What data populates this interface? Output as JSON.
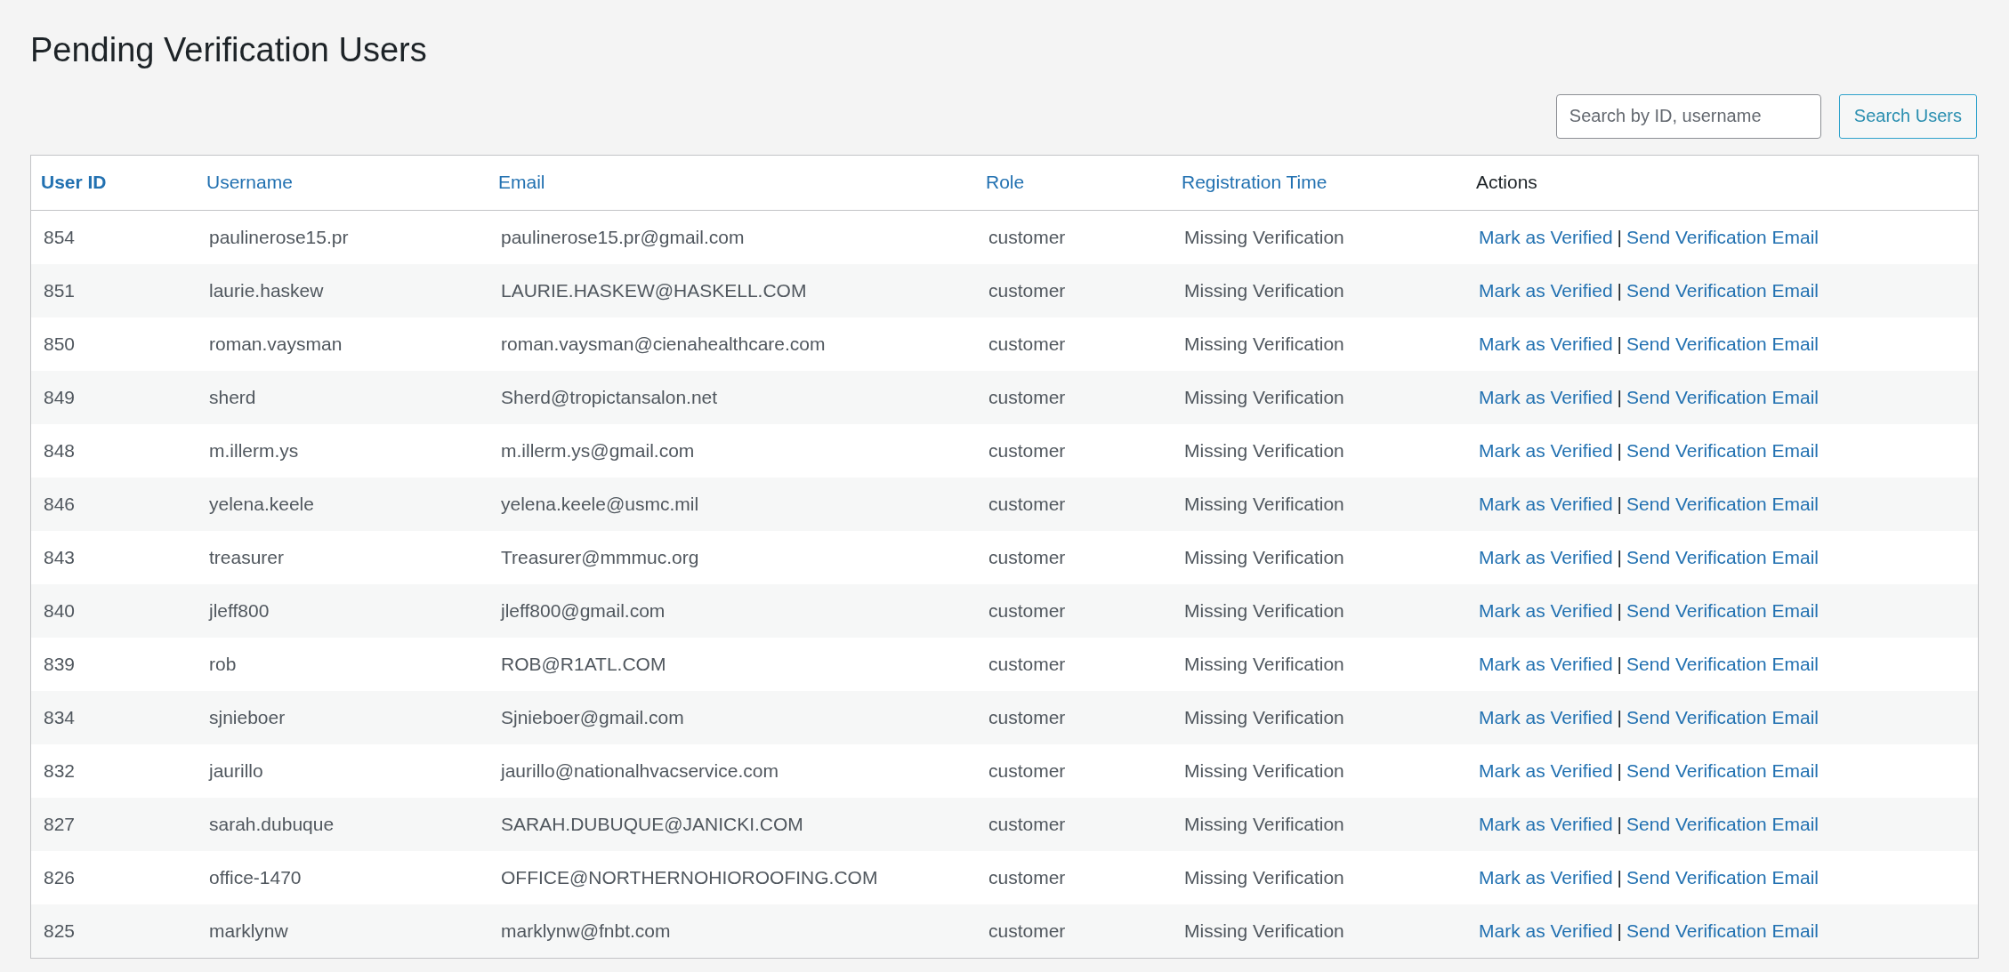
{
  "title": "Pending Verification Users",
  "search": {
    "placeholder": "Search by ID, username",
    "button": "Search Users"
  },
  "table": {
    "columns": [
      {
        "label": "User ID",
        "sortable": true,
        "sorted": true
      },
      {
        "label": "Username",
        "sortable": true,
        "sorted": false
      },
      {
        "label": "Email",
        "sortable": true,
        "sorted": false
      },
      {
        "label": "Role",
        "sortable": true,
        "sorted": false
      },
      {
        "label": "Registration Time",
        "sortable": true,
        "sorted": false
      },
      {
        "label": "Actions",
        "sortable": false,
        "sorted": false
      }
    ],
    "rows": [
      {
        "id": "854",
        "username": "paulinerose15.pr",
        "email": "paulinerose15.pr@gmail.com",
        "role": "customer",
        "registration": "Missing Verification",
        "actions": [
          "Mark as Verified",
          "Send Verification Email"
        ],
        "separator": "|"
      },
      {
        "id": "851",
        "username": "laurie.haskew",
        "email": "LAURIE.HASKEW@HASKELL.COM",
        "role": "customer",
        "registration": "Missing Verification",
        "actions": [
          "Mark as Verified",
          "Send Verification Email"
        ],
        "separator": "|"
      },
      {
        "id": "850",
        "username": "roman.vaysman",
        "email": "roman.vaysman@cienahealthcare.com",
        "role": "customer",
        "registration": "Missing Verification",
        "actions": [
          "Mark as Verified",
          "Send Verification Email"
        ],
        "separator": "|"
      },
      {
        "id": "849",
        "username": "sherd",
        "email": "Sherd@tropictansalon.net",
        "role": "customer",
        "registration": "Missing Verification",
        "actions": [
          "Mark as Verified",
          "Send Verification Email"
        ],
        "separator": "|"
      },
      {
        "id": "848",
        "username": "m.illerm.ys",
        "email": "m.illerm.ys@gmail.com",
        "role": "customer",
        "registration": "Missing Verification",
        "actions": [
          "Mark as Verified",
          "Send Verification Email"
        ],
        "separator": "|"
      },
      {
        "id": "846",
        "username": "yelena.keele",
        "email": "yelena.keele@usmc.mil",
        "role": "customer",
        "registration": "Missing Verification",
        "actions": [
          "Mark as Verified",
          "Send Verification Email"
        ],
        "separator": "|"
      },
      {
        "id": "843",
        "username": "treasurer",
        "email": "Treasurer@mmmuc.org",
        "role": "customer",
        "registration": "Missing Verification",
        "actions": [
          "Mark as Verified",
          "Send Verification Email"
        ],
        "separator": "|"
      },
      {
        "id": "840",
        "username": "jleff800",
        "email": "jleff800@gmail.com",
        "role": "customer",
        "registration": "Missing Verification",
        "actions": [
          "Mark as Verified",
          "Send Verification Email"
        ],
        "separator": "|"
      },
      {
        "id": "839",
        "username": "rob",
        "email": "ROB@R1ATL.COM",
        "role": "customer",
        "registration": "Missing Verification",
        "actions": [
          "Mark as Verified",
          "Send Verification Email"
        ],
        "separator": "|"
      },
      {
        "id": "834",
        "username": "sjnieboer",
        "email": "Sjnieboer@gmail.com",
        "role": "customer",
        "registration": "Missing Verification",
        "actions": [
          "Mark as Verified",
          "Send Verification Email"
        ],
        "separator": "|"
      },
      {
        "id": "832",
        "username": "jaurillo",
        "email": "jaurillo@nationalhvacservice.com",
        "role": "customer",
        "registration": "Missing Verification",
        "actions": [
          "Mark as Verified",
          "Send Verification Email"
        ],
        "separator": "|"
      },
      {
        "id": "827",
        "username": "sarah.dubuque",
        "email": "SARAH.DUBUQUE@JANICKI.COM",
        "role": "customer",
        "registration": "Missing Verification",
        "actions": [
          "Mark as Verified",
          "Send Verification Email"
        ],
        "separator": "|"
      },
      {
        "id": "826",
        "username": "office-1470",
        "email": "OFFICE@NORTHERNOHIOROOFING.COM",
        "role": "customer",
        "registration": "Missing Verification",
        "actions": [
          "Mark as Verified",
          "Send Verification Email"
        ],
        "separator": "|"
      },
      {
        "id": "825",
        "username": "marklynw",
        "email": "marklynw@fnbt.com",
        "role": "customer",
        "registration": "Missing Verification",
        "actions": [
          "Mark as Verified",
          "Send Verification Email"
        ],
        "separator": "|"
      }
    ]
  }
}
